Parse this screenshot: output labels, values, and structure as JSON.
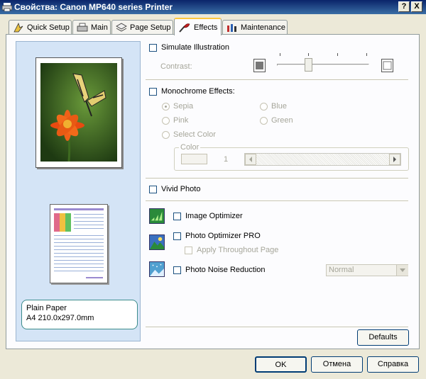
{
  "window": {
    "title": "Свойства: Canon MP640 series Printer",
    "help_btn": "?",
    "close_btn": "X"
  },
  "tabs": [
    {
      "label": "Quick Setup"
    },
    {
      "label": "Main"
    },
    {
      "label": "Page Setup"
    },
    {
      "label": "Effects"
    },
    {
      "label": "Maintenance"
    }
  ],
  "preview": {
    "paper_line1": "Plain Paper",
    "paper_line2": "A4 210.0x297.0mm"
  },
  "effects": {
    "simulate_illustration": "Simulate Illustration",
    "contrast_label": "Contrast:",
    "monochrome": "Monochrome Effects:",
    "sepia": "Sepia",
    "blue": "Blue",
    "pink": "Pink",
    "green": "Green",
    "select_color": "Select Color",
    "color_group": "Color",
    "color_value": "1",
    "vivid_photo": "Vivid Photo",
    "image_optimizer": "Image Optimizer",
    "photo_optimizer_pro": "Photo Optimizer PRO",
    "apply_throughout": "Apply Throughout Page",
    "noise_reduction": "Photo Noise Reduction",
    "noise_level": "Normal",
    "defaults_btn": "Defaults"
  },
  "footer": {
    "ok": "OK",
    "cancel": "Отмена",
    "help": "Справка"
  }
}
